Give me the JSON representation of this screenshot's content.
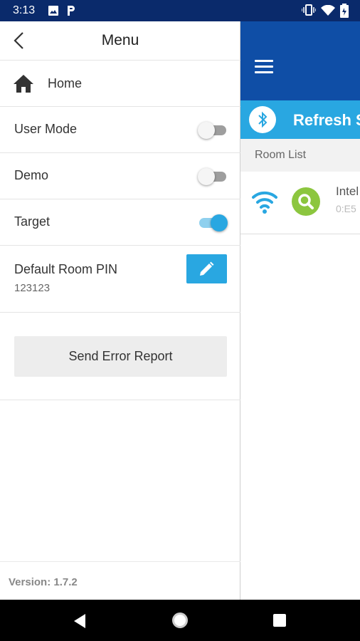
{
  "status_bar": {
    "time": "3:13",
    "icons": [
      "image-icon",
      "parking-p-icon",
      "vibrate-icon",
      "wifi-icon",
      "battery-icon"
    ]
  },
  "drawer": {
    "title": "Menu",
    "home_label": "Home",
    "toggles": [
      {
        "label": "User Mode",
        "on": false
      },
      {
        "label": "Demo",
        "on": false
      },
      {
        "label": "Target",
        "on": true
      }
    ],
    "pin": {
      "label": "Default Room PIN",
      "value": "123123"
    },
    "send_error_report": "Send Error Report",
    "version": "Version: 1.7.2"
  },
  "background_app": {
    "refresh_label": "Refresh S",
    "room_list_header": "Room List",
    "room": {
      "name": "Intel",
      "mac": "0:E5"
    }
  },
  "colors": {
    "status_bar": "#0a2a6b",
    "toolbar": "#0f4ea6",
    "accent": "#29a7e1",
    "search_green": "#8cc63f"
  }
}
